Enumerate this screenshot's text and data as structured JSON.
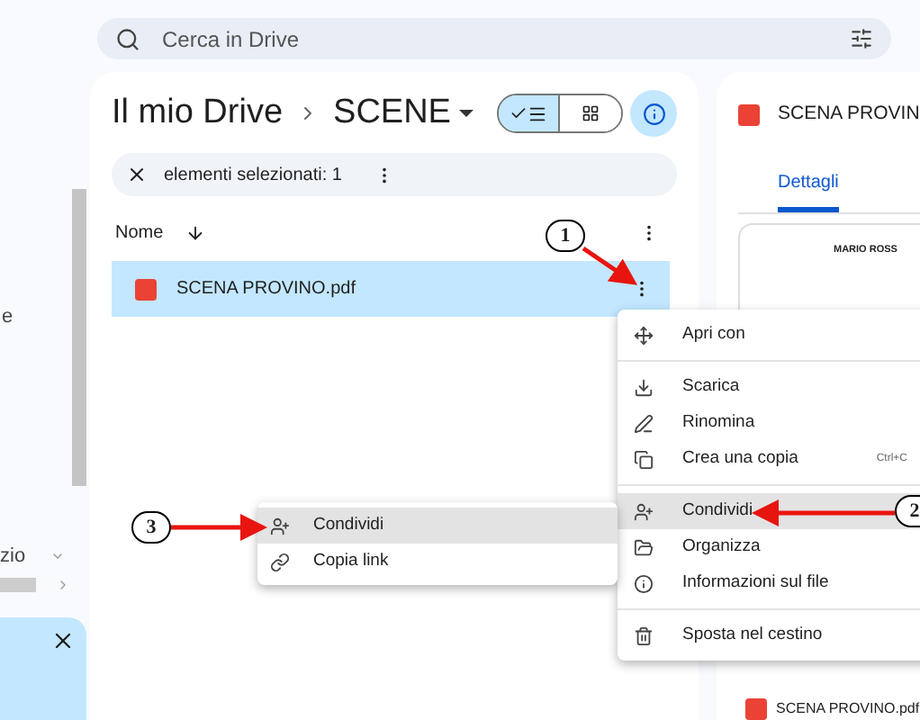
{
  "search": {
    "placeholder": "Cerca in Drive"
  },
  "sidebar": {
    "texts": [
      "e",
      "zio"
    ]
  },
  "breadcrumb": {
    "root": "Il mio Drive",
    "current": "SCENE"
  },
  "view_toggle": [
    {
      "kind": "list",
      "selected": true
    },
    {
      "kind": "grid",
      "selected": false
    }
  ],
  "info_button": {
    "selected": true
  },
  "selection_bar": {
    "text": "elementi selezionati: 1"
  },
  "file_list": {
    "column": "Nome",
    "rows": [
      {
        "name": "SCENA PROVINO.pdf",
        "selected": true
      }
    ]
  },
  "context_menu": {
    "groups": [
      [
        {
          "label": "Apri con",
          "highlighted": false
        }
      ],
      [
        {
          "label": "Scarica",
          "highlighted": false
        },
        {
          "label": "Rinomina",
          "highlighted": false
        },
        {
          "label": "Crea una copia",
          "shortcut": "Ctrl+C",
          "highlighted": false
        }
      ],
      [
        {
          "label": "Condividi",
          "highlighted": true
        },
        {
          "label": "Organizza",
          "highlighted": false
        },
        {
          "label": "Informazioni sul file",
          "highlighted": false
        }
      ],
      [
        {
          "label": "Sposta nel cestino",
          "highlighted": false
        }
      ]
    ]
  },
  "share_submenu": {
    "items": [
      {
        "label": "Condividi",
        "highlighted": true
      },
      {
        "label": "Copia link",
        "highlighted": false
      }
    ]
  },
  "details_panel": {
    "title": "SCENA PROVIN",
    "tabs": [
      {
        "label": "Dettagli",
        "selected": true
      }
    ],
    "preview_text": "MARIO ROSS",
    "file": "SCENA PROVINO.pdf"
  },
  "callouts": [
    {
      "label": "1"
    },
    {
      "label": "2"
    },
    {
      "label": "3"
    }
  ]
}
